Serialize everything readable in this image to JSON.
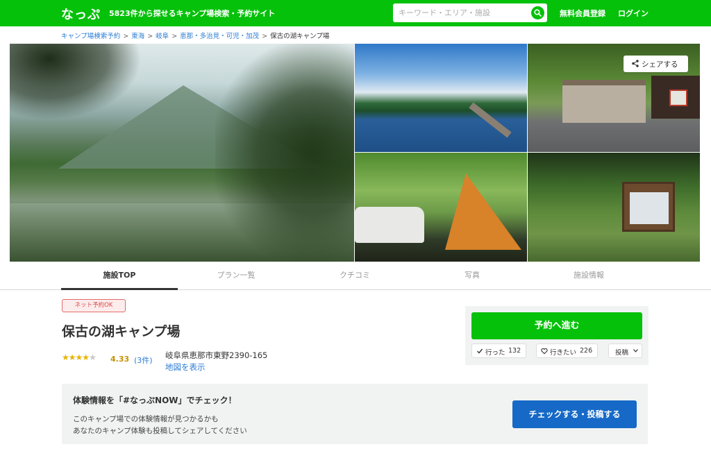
{
  "header": {
    "logo": "なっぷ",
    "tagline": "5823件から探せるキャンプ場検索・予約サイト",
    "search_placeholder": "キーワード・エリア・施設",
    "signup_label": "無料会員登録",
    "login_label": "ログイン",
    "accent_color": "#06c10a"
  },
  "breadcrumb": {
    "items": [
      "キャンプ場検索予約",
      "東海",
      "岐阜",
      "恵那・多治見・可児・加茂"
    ],
    "separator": ">",
    "current": "保古の湖キャンプ場"
  },
  "gallery": {
    "share_label": "シェアする"
  },
  "tabs": [
    {
      "label": "施設TOP",
      "active": true
    },
    {
      "label": "プラン一覧",
      "active": false
    },
    {
      "label": "クチコミ",
      "active": false
    },
    {
      "label": "写真",
      "active": false
    },
    {
      "label": "施設情報",
      "active": false
    }
  ],
  "facility": {
    "badge": "ネット予約OK",
    "name": "保古の湖キャンプ場",
    "rating": "4.33",
    "review_count": "(3件)",
    "address": "岐阜県恵那市東野2390-165",
    "map_link": "地図を表示"
  },
  "actions": {
    "reserve_label": "予約へ進む",
    "went_label": "行った",
    "went_count": "132",
    "want_label": "行きたい",
    "want_count": "226",
    "post_label": "投稿"
  },
  "now_banner": {
    "title": "体験情報を「#なっぷNOW」でチェック！",
    "line1": "このキャンプ場での体験情報が見つかるかも",
    "line2": "あなたのキャンプ体験も投稿してシェアしてください",
    "button_label": "チェックする・投稿する",
    "button_color": "#1669c6"
  }
}
